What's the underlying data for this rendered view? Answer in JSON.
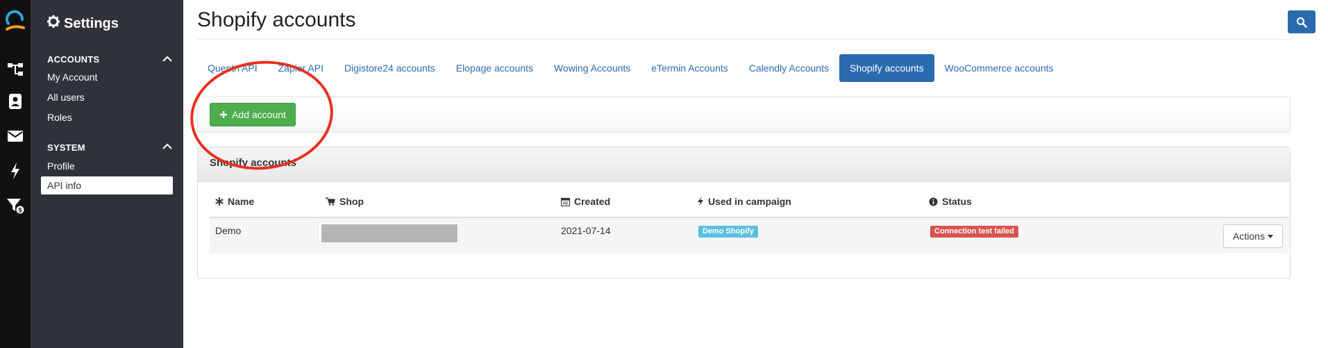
{
  "sidebar": {
    "title": "Settings",
    "sections": [
      {
        "heading": "ACCOUNTS",
        "items": [
          "My Account",
          "All users",
          "Roles"
        ]
      },
      {
        "heading": "SYSTEM",
        "items": [
          "Profile",
          "API info"
        ]
      }
    ],
    "active_item": "API info"
  },
  "page": {
    "title": "Shopify accounts"
  },
  "tabs": [
    {
      "label": "Quentn API"
    },
    {
      "label": "Zapier API"
    },
    {
      "label": "Digistore24 accounts"
    },
    {
      "label": "Elopage accounts"
    },
    {
      "label": "Wowing Accounts"
    },
    {
      "label": "eTermin Accounts"
    },
    {
      "label": "Calendly Accounts"
    },
    {
      "label": "Shopify accounts",
      "active": true
    },
    {
      "label": "WooCommerce accounts"
    }
  ],
  "toolbar": {
    "add_label": "Add account"
  },
  "panel": {
    "title": "Shopify accounts",
    "columns": [
      "Name",
      "Shop",
      "Created",
      "Used in campaign",
      "Status"
    ],
    "rows": [
      {
        "name": "Demo",
        "created": "2021-07-14",
        "campaign": "Demo Shopify",
        "status": "Connection test failed",
        "actions": "Actions"
      }
    ]
  },
  "colors": {
    "primary": "#2a6bb0",
    "success": "#4cae4c",
    "info": "#5bc0de",
    "danger": "#d9534f",
    "sidebar": "#2f3339",
    "highlight_circle": "#e8301f"
  },
  "icons": [
    "logo-icon",
    "flow-icon",
    "contacts-icon",
    "mail-icon",
    "bolt-icon",
    "funnel-dollar-icon",
    "gear-icon",
    "search-icon",
    "plus-icon",
    "asterisk-icon",
    "cart-icon",
    "calendar-icon",
    "info-circle-icon",
    "caret-down-icon"
  ]
}
